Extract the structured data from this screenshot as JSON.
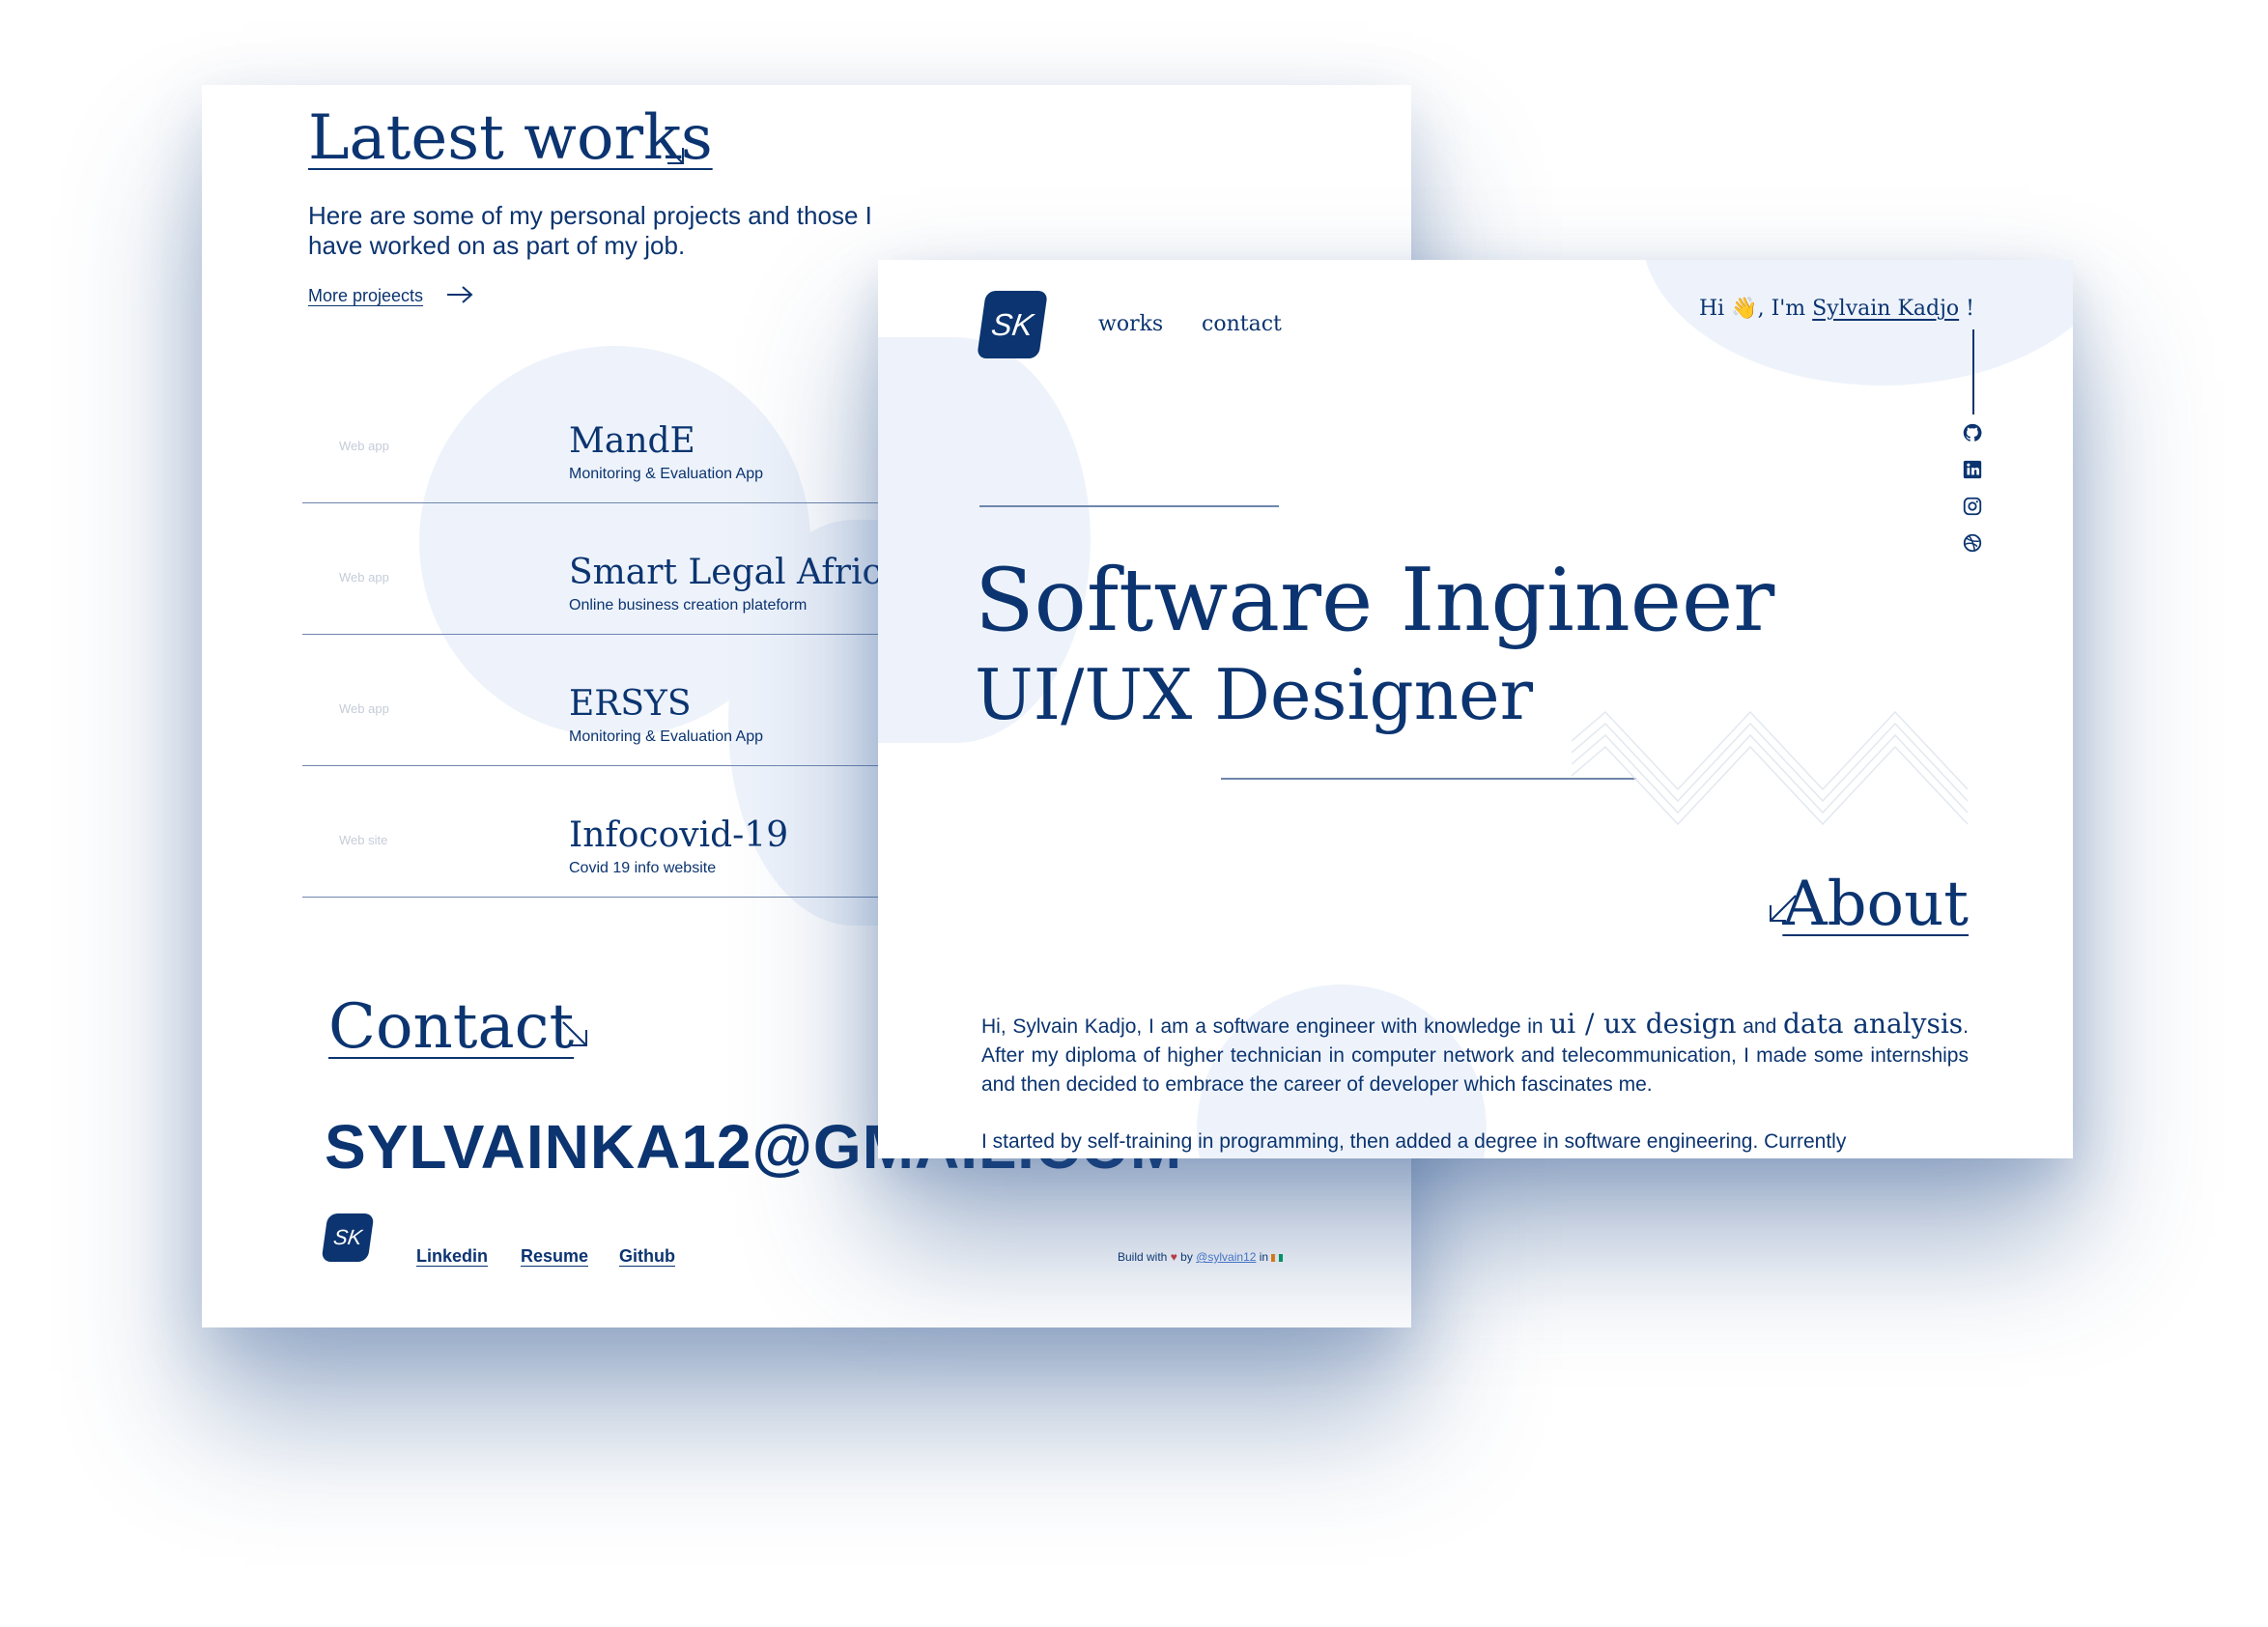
{
  "works_section": {
    "title": "Latest works",
    "intro": "Here are some of my personal projects and those I have worked on as part of my job.",
    "more_link": "More projeects",
    "projects": [
      {
        "type": "Web app",
        "name": "MandE",
        "desc": "Monitoring  & Evaluation App"
      },
      {
        "type": "Web app",
        "name": "Smart Legal Africa",
        "desc": "Online business creation plateform"
      },
      {
        "type": "Web app",
        "name": "ERSYS",
        "desc": "Monitoring  & Evaluation App"
      },
      {
        "type": "Web site",
        "name": "Infocovid-19",
        "desc": "Covid 19 info website"
      }
    ]
  },
  "contact_section": {
    "title": "Contact",
    "email": "SYLVAINKA12@GMAIL.COM"
  },
  "footer": {
    "logo": "SK",
    "links": [
      "Linkedin",
      "Resume",
      "Github"
    ],
    "credit_prefix": "Build with",
    "credit_heart": "♥",
    "credit_by": "by",
    "credit_handle": "@sylvain12",
    "credit_in": "in"
  },
  "hero": {
    "logo": "SK",
    "nav": [
      "works",
      "contact"
    ],
    "greeting_prefix": "Hi",
    "greeting_wave": "👋",
    "greeting_im": ", I'm",
    "greeting_name": "Sylvain Kadjo",
    "greeting_suffix": "!",
    "social_icons": [
      "github-icon",
      "linkedin-icon",
      "instagram-icon",
      "dribbble-icon"
    ],
    "title": "Software Ingineer",
    "subtitle": "UI/UX Designer"
  },
  "about": {
    "title": "About",
    "p1_start": "Hi, Sylvain Kadjo, I am a software engineer with knowledge in",
    "p1_hl1": "ui / ux design",
    "p1_and": "and",
    "p1_hl2": "data analysis",
    "p1_rest": ". After my diploma of higher technician in computer network and telecommunication, I made some internships and then decided to embrace the career of developer which fascinates me.",
    "p2": "I started by self-training in programming, then added a degree in software engineering. Currently"
  },
  "colors": {
    "primary": "#0b3470",
    "blob": "#eef3fb",
    "divider": "#6f86ad"
  }
}
